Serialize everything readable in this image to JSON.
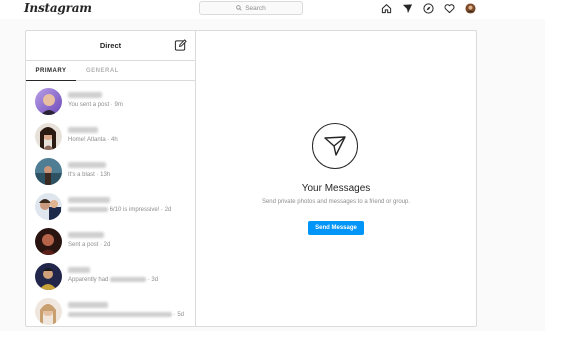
{
  "topbar": {
    "logo": "Instagram",
    "search_placeholder": "Search",
    "icons": [
      "home-icon",
      "direct-icon",
      "explore-icon",
      "activity-icon",
      "profile-avatar"
    ]
  },
  "inbox": {
    "title": "Direct",
    "tabs": [
      "PRIMARY",
      "GENERAL"
    ],
    "threads": [
      {
        "snippet": "You sent a post · 9m"
      },
      {
        "snippet": "Home! Atlanta · 4h"
      },
      {
        "snippet": "It's a blast · 13h"
      },
      {
        "snippet": "6/10 is impressive! · 2d"
      },
      {
        "snippet": "Sent a post · 2d"
      },
      {
        "snippet": "Apparently had",
        "time": "· 3d"
      },
      {
        "snippet": "· 5d"
      }
    ]
  },
  "empty_state": {
    "title": "Your Messages",
    "subtitle": "Send private photos and messages to a friend or group.",
    "button_label": "Send Message"
  },
  "colors": {
    "accent": "#0095f6",
    "border": "#dbdbdb",
    "muted": "#8e8e8e"
  }
}
